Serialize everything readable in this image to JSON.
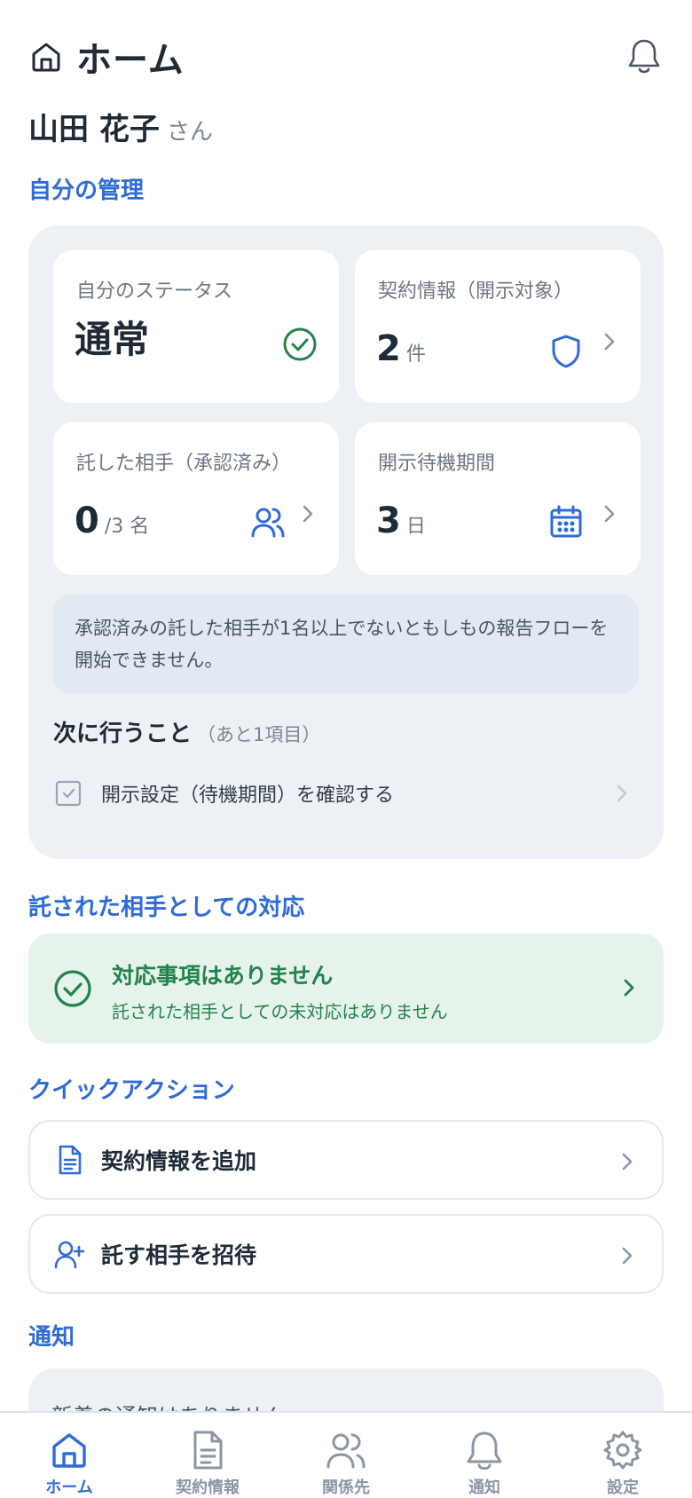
{
  "header": {
    "title": "ホーム",
    "home_icon": "home-icon",
    "notification_icon": "bell-icon"
  },
  "user": {
    "name": "山田 花子",
    "suffix": "さん"
  },
  "self_section": {
    "title": "自分の管理",
    "cards": [
      {
        "label": "自分のステータス",
        "value": "通常",
        "unit": "",
        "icon": "check-circle-icon"
      },
      {
        "label": "契約情報（開示対象）",
        "value": "2",
        "unit": "件",
        "icon": "shield-icon"
      },
      {
        "label": "託した相手（承認済み）",
        "value": "0",
        "unit": "/3 名",
        "icon": "users-icon"
      },
      {
        "label": "開示待機期間",
        "value": "3",
        "unit": "日",
        "icon": "calendar-icon"
      }
    ],
    "notice": "承認済みの託した相手が1名以上でないともしもの報告フローを開始できません。",
    "next": {
      "title": "次に行うこと",
      "remaining": "（あと1項目）",
      "items": [
        {
          "label": "開示設定（待機期間）を確認する"
        }
      ]
    }
  },
  "trusted_section": {
    "title": "託された相手としての対応",
    "status_title": "対応事項はありません",
    "status_sub": "託された相手としての未対応はありません"
  },
  "quick_actions": {
    "title": "クイックアクション",
    "items": [
      {
        "label": "契約情報を追加",
        "icon": "document-icon"
      },
      {
        "label": "託す相手を招待",
        "icon": "user-plus-icon"
      }
    ]
  },
  "notifications": {
    "title": "通知",
    "empty_text": "新着の通知はありません"
  },
  "tabbar": {
    "tabs": [
      {
        "label": "ホーム",
        "icon": "home-icon",
        "active": true
      },
      {
        "label": "契約情報",
        "icon": "document-icon",
        "active": false
      },
      {
        "label": "関係先",
        "icon": "users-icon",
        "active": false
      },
      {
        "label": "通知",
        "icon": "bell-icon",
        "active": false
      },
      {
        "label": "設定",
        "icon": "gear-icon",
        "active": false
      }
    ]
  },
  "colors": {
    "accent": "#2f6bd8",
    "success": "#23834c",
    "panel": "#edf1f5",
    "text": "#1f2a37"
  }
}
